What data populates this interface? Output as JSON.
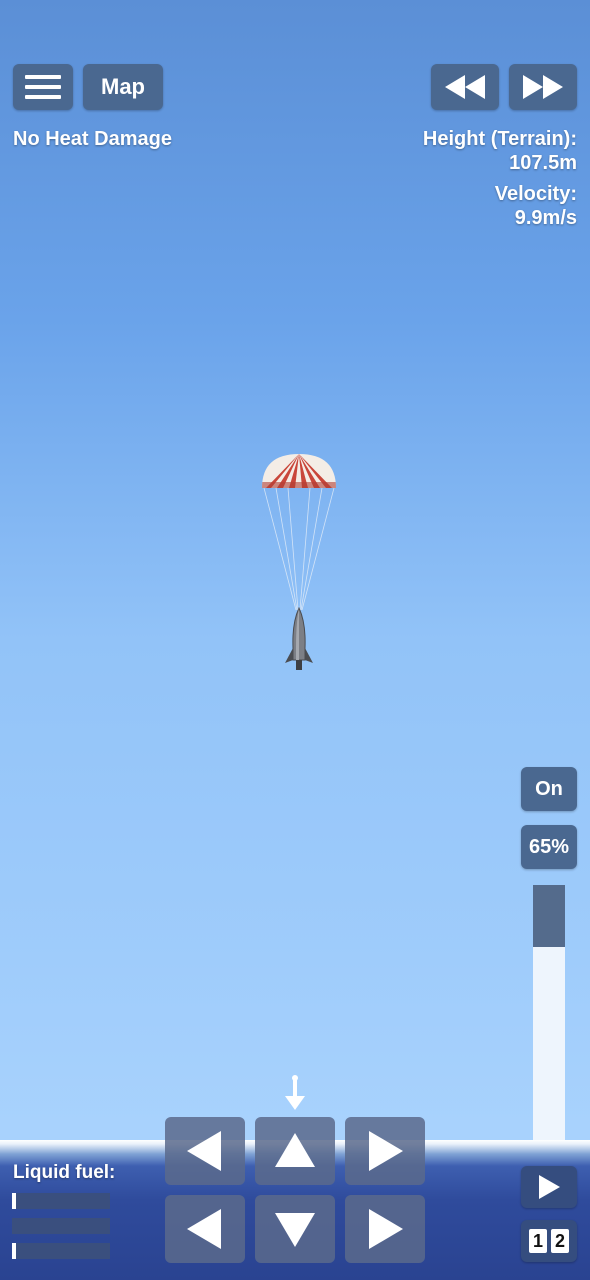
{
  "topbar": {
    "menu_icon": "hamburger-menu-icon",
    "map_label": "Map",
    "rewind_icon": "rewind-icon",
    "fast_forward_icon": "fast-forward-icon"
  },
  "status": {
    "heat": "No Heat Damage",
    "height_label": "Height (Terrain):",
    "height_value": "107.5m",
    "velocity_label": "Velocity:",
    "velocity_value": "9.9m/s"
  },
  "throttle": {
    "toggle_label": "On",
    "percent_label": "65%",
    "level": 0.65
  },
  "fuel": {
    "label": "Liquid fuel:",
    "levels": [
      0.04,
      0.0,
      0.04
    ]
  },
  "stages": {
    "play_icon": "play-icon",
    "digits": [
      "1",
      "2"
    ]
  },
  "controls": {
    "rotate_left_icon": "arrow-left-icon",
    "up_icon": "arrow-up-icon",
    "rotate_right_icon": "arrow-right-icon",
    "left_icon": "arrow-left-icon",
    "down_icon": "arrow-down-icon",
    "right_icon": "arrow-right-icon"
  },
  "colors": {
    "button": "#4a6890",
    "parachute_red": "#c9463a",
    "parachute_white": "#f4ede6"
  }
}
